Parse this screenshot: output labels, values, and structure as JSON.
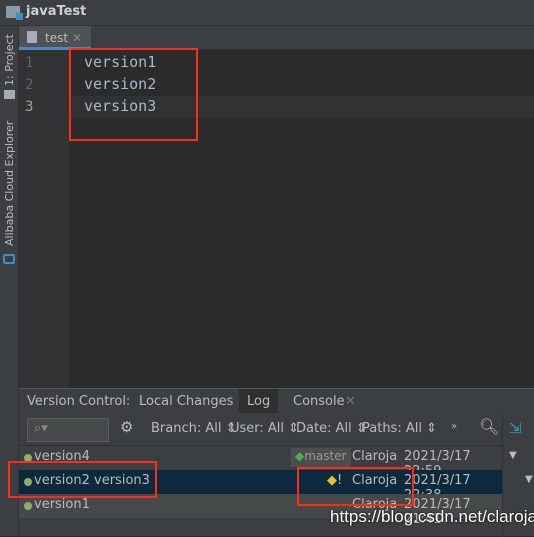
{
  "title": "javaTest",
  "left_tools": [
    "1: Project",
    "Alibaba Cloud Explorer"
  ],
  "editor": {
    "tab": "test",
    "lines": [
      {
        "n": "1",
        "text": "version1"
      },
      {
        "n": "2",
        "text": "version2"
      },
      {
        "n": "3",
        "text": "version3"
      }
    ]
  },
  "panel": {
    "label": "Version Control:",
    "tabs": [
      "Local Changes",
      "Log",
      "Console"
    ],
    "active_tab": "Log",
    "filters": [
      "Branch: All",
      "User: All",
      "Date: All",
      "Paths: All"
    ],
    "commits": [
      {
        "message": "version4",
        "ref": "master",
        "author": "Claroja",
        "date": "2021/3/17 22:59"
      },
      {
        "message": "version2 version3",
        "ref": "!",
        "author": "Claroja",
        "date": "2021/3/17 22:38",
        "selected": true
      },
      {
        "message": "version1",
        "ref": "",
        "author": "Claroja",
        "date": "2021/3/17 21:41"
      }
    ]
  },
  "watermark": "https://blog.csdn.net/claroja"
}
